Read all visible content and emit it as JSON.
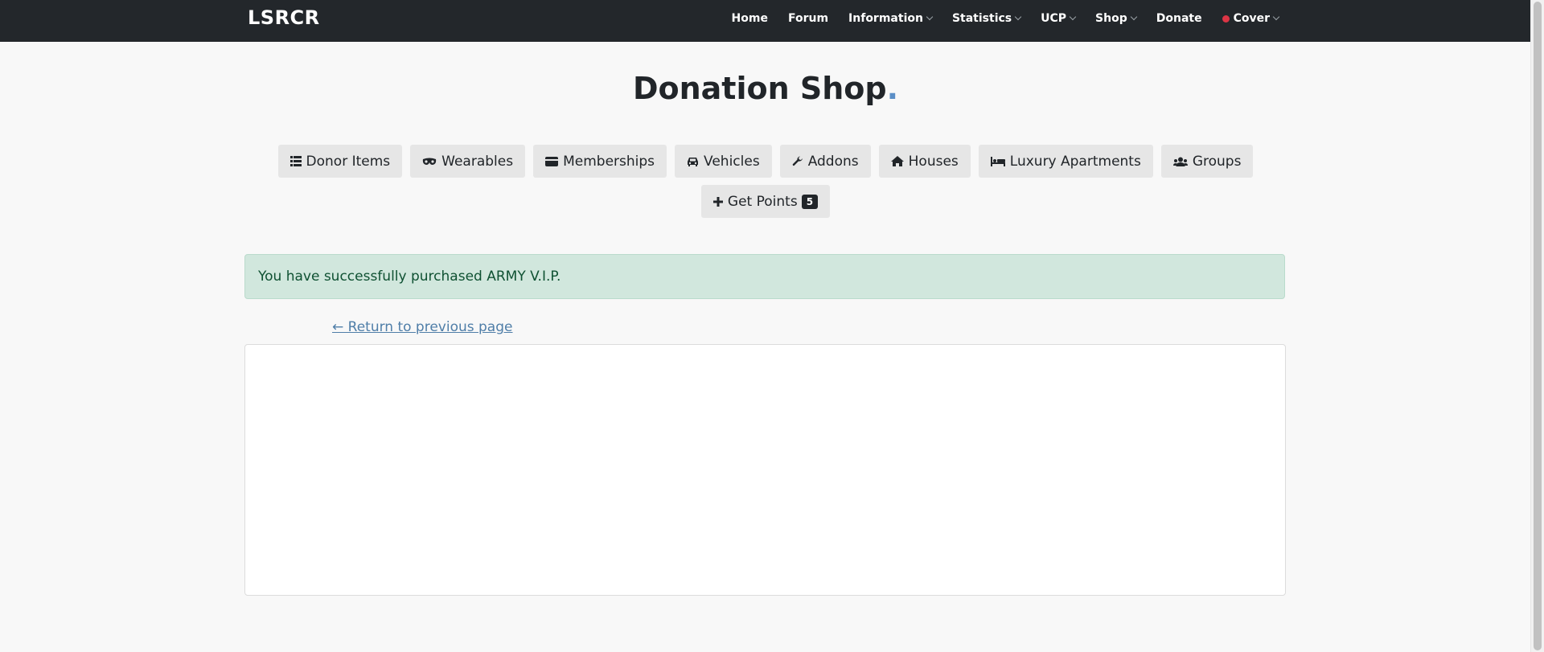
{
  "navbar": {
    "brand": "LSRCR",
    "items": [
      {
        "label": "Home",
        "dropdown": false
      },
      {
        "label": "Forum",
        "dropdown": false
      },
      {
        "label": "Information",
        "dropdown": true
      },
      {
        "label": "Statistics",
        "dropdown": true
      },
      {
        "label": "UCP",
        "dropdown": true
      },
      {
        "label": "Shop",
        "dropdown": true
      },
      {
        "label": "Donate",
        "dropdown": false
      },
      {
        "label": "Cover",
        "dropdown": true,
        "status_dot_color": "#dc3545"
      }
    ]
  },
  "page": {
    "title": "Donation Shop",
    "title_suffix": ".",
    "title_suffix_color": "#5b8fc7"
  },
  "categories": [
    {
      "label": "Donor Items",
      "icon": "list-icon"
    },
    {
      "label": "Wearables",
      "icon": "mask-icon"
    },
    {
      "label": "Memberships",
      "icon": "card-icon"
    },
    {
      "label": "Vehicles",
      "icon": "car-icon"
    },
    {
      "label": "Addons",
      "icon": "wrench-icon"
    },
    {
      "label": "Houses",
      "icon": "home-icon"
    },
    {
      "label": "Luxury Apartments",
      "icon": "bed-icon"
    },
    {
      "label": "Groups",
      "icon": "users-icon"
    }
  ],
  "get_points": {
    "label": "Get Points",
    "icon": "plus-icon",
    "badge": "5"
  },
  "alert": {
    "message": "You have successfully purchased ARMY V.I.P.",
    "color": "#d1e7dd"
  },
  "return_link": {
    "label": "← Return to previous page"
  }
}
